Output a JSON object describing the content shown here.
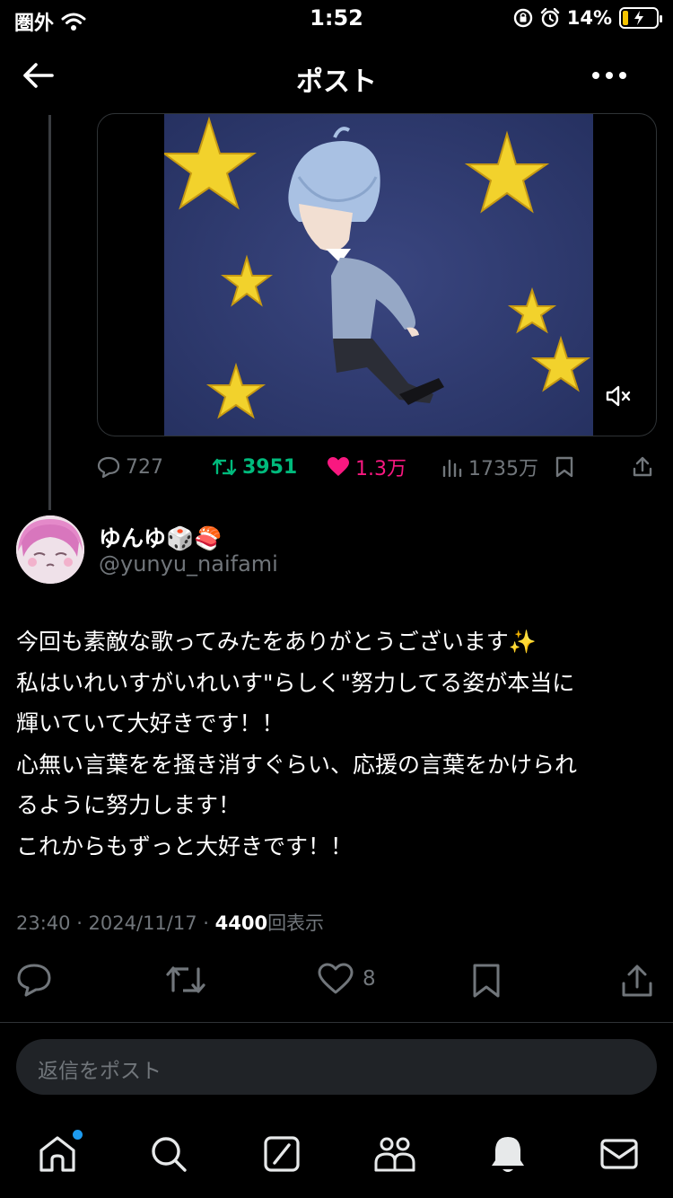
{
  "status_bar": {
    "carrier": "圏外",
    "time": "1:52",
    "battery": "14%"
  },
  "header": {
    "title": "ポスト"
  },
  "parent_post": {
    "stats": {
      "replies": "727",
      "retweets": "3951",
      "likes": "1.3万",
      "views": "1735万"
    }
  },
  "post": {
    "author_name": "ゆんゆ🎲🍣",
    "author_handle": "@yunyu_naifami",
    "body_lines": [
      "今回も素敵な歌ってみたをありがとうございます✨",
      "私はいれいすがいれいす\"らしく\"努力してる姿が本当に",
      "輝いていて大好きです！！",
      "心無い言葉をを掻き消すぐらい、応援の言葉をかけられ",
      "るように努力します！",
      "これからもずっと大好きです！！"
    ],
    "timestamp": "23:40 · 2024/11/17 · ",
    "views_count": "4400",
    "views_label": "回表示",
    "like_count": "8"
  },
  "reply_box": {
    "placeholder": "返信をポスト"
  },
  "icons": {
    "back": "arrow-left-icon",
    "more": "more-dots-icon",
    "mute": "speaker-muted-icon",
    "reply": "reply-bubble-icon",
    "retweet": "retweet-icon",
    "like": "heart-icon",
    "views": "bar-chart-icon",
    "bookmark": "bookmark-icon",
    "share": "share-icon",
    "tabs": [
      "home-icon",
      "search-icon",
      "grok-icon",
      "communities-icon",
      "notifications-icon",
      "messages-icon"
    ]
  },
  "colors": {
    "retweet_active": "#00ba7c",
    "like_active": "#f91880",
    "muted_text": "#71767b",
    "notification_dot": "#1d9bf0"
  }
}
